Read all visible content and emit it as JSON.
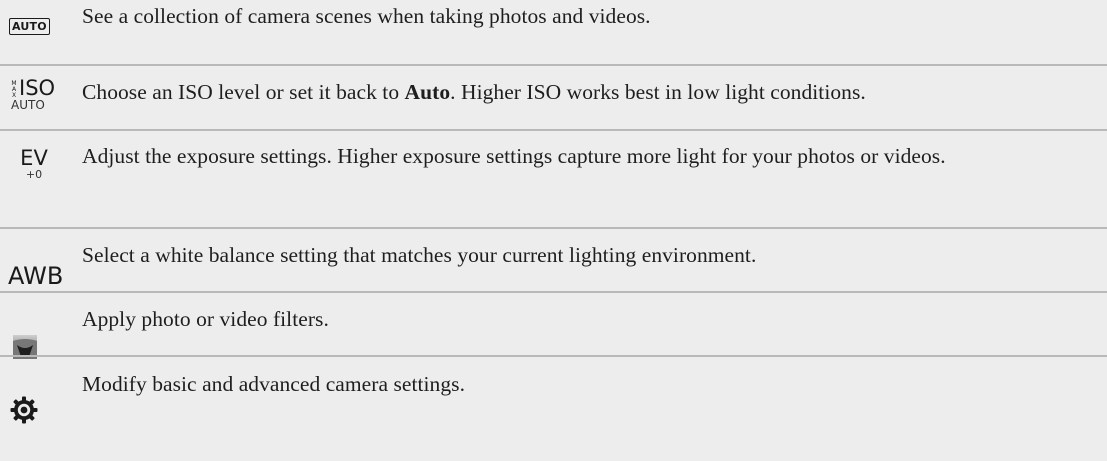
{
  "rows": [
    {
      "icon": "auto-scene-icon",
      "icon_text": "AUTO",
      "text": "See a collection of camera scenes when taking photos and videos."
    },
    {
      "icon": "iso-icon",
      "icon_text": "ISO",
      "icon_subtext": "AUTO",
      "icon_max": "MAX",
      "text_before": "Choose an ISO level or set it back to ",
      "text_bold": "Auto",
      "text_after": ". Higher ISO works best in low light conditions."
    },
    {
      "icon": "exposure-icon",
      "icon_text": "EV",
      "icon_subtext": "+0",
      "text": "Adjust the exposure settings. Higher exposure settings capture more light for your photos or videos."
    },
    {
      "icon": "white-balance-icon",
      "icon_text": "AWB",
      "text": "Select a white balance setting that matches your current lighting environment."
    },
    {
      "icon": "filter-icon",
      "text": "Apply photo or video filters."
    },
    {
      "icon": "gear-icon",
      "text": "Modify basic and advanced camera settings."
    }
  ],
  "colors": {
    "row_background": "#ededed",
    "divider": "#b9b9b9",
    "text": "#1e1e1e"
  }
}
